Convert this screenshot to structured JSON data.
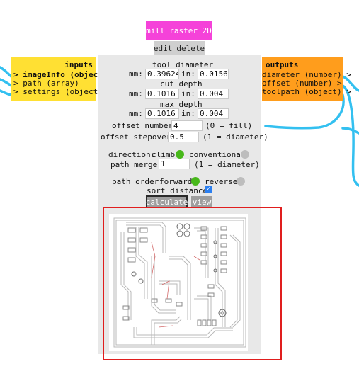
{
  "module": {
    "title": "mill raster 2D",
    "actions": {
      "edit": "edit",
      "delete": "delete"
    }
  },
  "inputs": {
    "header": "inputs",
    "items": [
      "> imageInfo (object)",
      "> path (array)",
      "> settings (object)"
    ]
  },
  "outputs": {
    "header": "outputs",
    "items": [
      "diameter (number) >",
      "offset (number) >",
      "toolpath (object) >"
    ]
  },
  "settings": {
    "tool_diameter": {
      "label": "tool diameter",
      "mm_label": "mm:",
      "mm": "0.39624",
      "in_label": "in:",
      "in": "0.0156"
    },
    "cut_depth": {
      "label": "cut depth",
      "mm_label": "mm:",
      "mm": "0.1016",
      "in_label": "in:",
      "in": "0.004"
    },
    "max_depth": {
      "label": "max depth",
      "mm_label": "mm:",
      "mm": "0.1016",
      "in_label": "in:",
      "in": "0.004"
    },
    "offset_number": {
      "label": "offset number:",
      "value": "4",
      "hint": "(0 = fill)"
    },
    "offset_stepover": {
      "label": "offset stepover:",
      "value": "0.5",
      "hint": "(1 = diameter)"
    },
    "direction": {
      "label": "direction:",
      "option1": "climb",
      "option2": "conventional",
      "selected": "climb"
    },
    "path_merge": {
      "label": "path merge:",
      "value": "1",
      "hint": "(1 = diameter)"
    },
    "path_order": {
      "label": "path order:",
      "option1": "forward",
      "option2": "reverse",
      "selected": "forward"
    },
    "sort_distance": {
      "label": "sort distance:",
      "checked": true
    }
  },
  "buttons": {
    "calculate": "calculate",
    "view": "view"
  },
  "colors": {
    "title_bg": "#f542d9",
    "inputs_bg": "#ffe033",
    "outputs_bg": "#ff9d1c",
    "wire": "#33c0f0",
    "radio_on": "#47b81a",
    "highlight": "#e01e1e"
  }
}
